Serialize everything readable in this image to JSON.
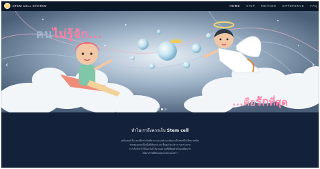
{
  "header": {
    "logo_text": "STEM CELL SYSTEM",
    "nav_items": [
      "HOME",
      "STEP",
      "METHOD",
      "DIFFERENCE",
      "FAQ"
    ]
  },
  "hero": {
    "headline_left_prefix": "คน",
    "headline_left_rest": "ไม่รู้จัก...",
    "headline_right_prefix": "...คือ",
    "headline_right_accent": "รัก",
    "headline_right_suffix": "ที่สุด",
    "prev_arrow": "‹",
    "next_arrow": "›"
  },
  "section": {
    "title_prefix": "ทำไมเราถึงควรเก็บ",
    "title_strong": "Stem cell",
    "body_lines": [
      "สเต็มเซลล์ คือ เซลล์ต้นกำเนิดที่สามารถแบ่งตัวและพัฒนาเป็นเซลล์อื่นได้หลายชนิด",
      "ช่วยซ่อมแซมเนื้อเยื่อที่เสียหาย และฟื้นฟูอวัยวะต่างๆ ของร่างกาย",
      "การเก็บรักษาไว้ตั้งแต่วันนี้ คือ ของขวัญที่ดีที่สุดสำหรับคนที่คุณรัก",
      "เพื่อสุขภาพที่ดีของทุกคนในครอบครัว"
    ]
  },
  "colors": {
    "brand_pink": "#ff7fa8",
    "bg_dark": "#13213a"
  },
  "icons": {
    "logo": "logo-mark-icon",
    "prev": "chevron-left-icon",
    "next": "chevron-right-icon"
  },
  "carousel": {
    "slides": 3,
    "active": 2
  }
}
